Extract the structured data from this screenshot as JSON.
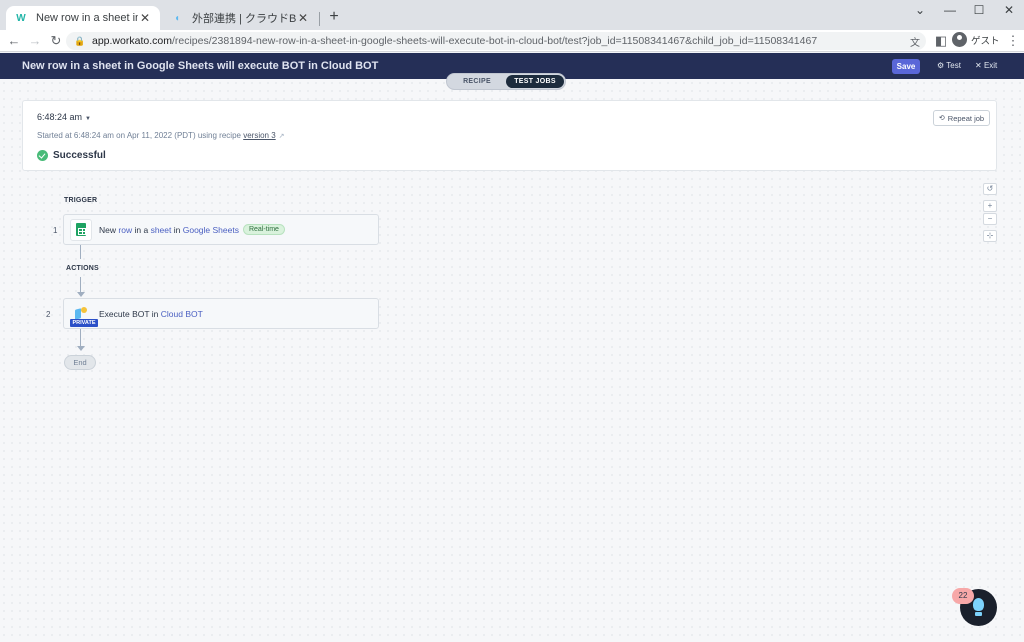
{
  "browser": {
    "tabs": [
      {
        "title": "New row in a sheet in Google Sh",
        "active": true,
        "favicon": "workato-logo-icon"
      },
      {
        "title": "外部連携 | クラウドBOT",
        "active": false,
        "favicon": "cloudbot-logo-icon"
      }
    ],
    "url_host": "app.workato.com",
    "url_path": "/recipes/2381894-new-row-in-a-sheet-in-google-sheets-will-execute-bot-in-cloud-bot/test?job_id=11508341467&child_job_id=11508341467",
    "profile_label": "ゲスト"
  },
  "header": {
    "recipe_title": "New row in a sheet in Google Sheets will execute BOT in Cloud BOT",
    "save_label": "Save",
    "test_label": "Test",
    "exit_label": "Exit",
    "mode_tabs": [
      {
        "label": "RECIPE",
        "active": false
      },
      {
        "label": "TEST JOBS",
        "active": true
      }
    ]
  },
  "job": {
    "time": "6:48:24 am",
    "started_prefix": "Started at 6:48:24 am on Apr 11, 2022 (PDT) using recipe",
    "version_link": "version 3",
    "status": "Successful",
    "repeat_label": "Repeat job"
  },
  "flow": {
    "trigger_label": "TRIGGER",
    "actions_label": "ACTIONS",
    "steps": [
      {
        "number": "1",
        "parts": [
          "New",
          "row",
          "in a",
          "sheet",
          "in",
          "Google Sheets"
        ],
        "badge": "Real-time",
        "icon": "google-sheets-icon"
      },
      {
        "number": "2",
        "parts": [
          "Execute BOT in",
          "Cloud BOT"
        ],
        "tag": "PRIVATE",
        "icon": "cloudbot-icon"
      }
    ],
    "end_label": "End"
  },
  "help": {
    "count": "22"
  }
}
